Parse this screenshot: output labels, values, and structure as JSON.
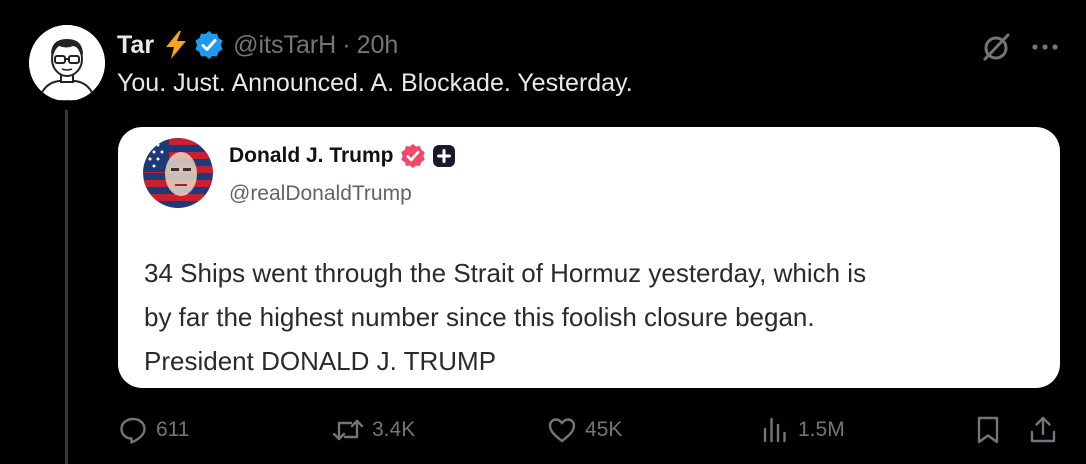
{
  "tweet": {
    "author": {
      "display_name": "Tar",
      "handle": "@itsTarH",
      "badge_icon": "lightning-bolt-icon",
      "verified_icon": "verified-badge-icon",
      "verified_color": "#1d9bf0"
    },
    "separator": "·",
    "time": "20h",
    "text": "You. Just. Announced. A. Blockade. Yesterday.",
    "top_icons": [
      "grok-icon",
      "more-icon"
    ]
  },
  "quoted_post": {
    "author": {
      "display_name": "Donald J. Trump",
      "handle": "@realDonaldTrump",
      "verified_icon": "verified-badge-icon",
      "verified_color": "#ec4b6b",
      "extra_icon": "plus-badge-icon"
    },
    "lines": [
      "34 Ships went through the Strait of Hormuz yesterday, which is",
      "by far the highest number since this foolish closure began.",
      "President DONALD J. TRUMP"
    ]
  },
  "actions": {
    "reply": {
      "icon": "reply-icon",
      "count": "611"
    },
    "repost": {
      "icon": "repost-icon",
      "count": "3.4K"
    },
    "like": {
      "icon": "heart-icon",
      "count": "45K"
    },
    "views": {
      "icon": "views-icon",
      "count": "1.5M"
    },
    "bookmark": {
      "icon": "bookmark-icon"
    },
    "share": {
      "icon": "share-icon"
    }
  },
  "colors": {
    "background": "#000000",
    "primary_text": "#e7e9ea",
    "secondary_text": "#71767b",
    "thread_line": "#333639",
    "bolt": "#f5a623"
  }
}
